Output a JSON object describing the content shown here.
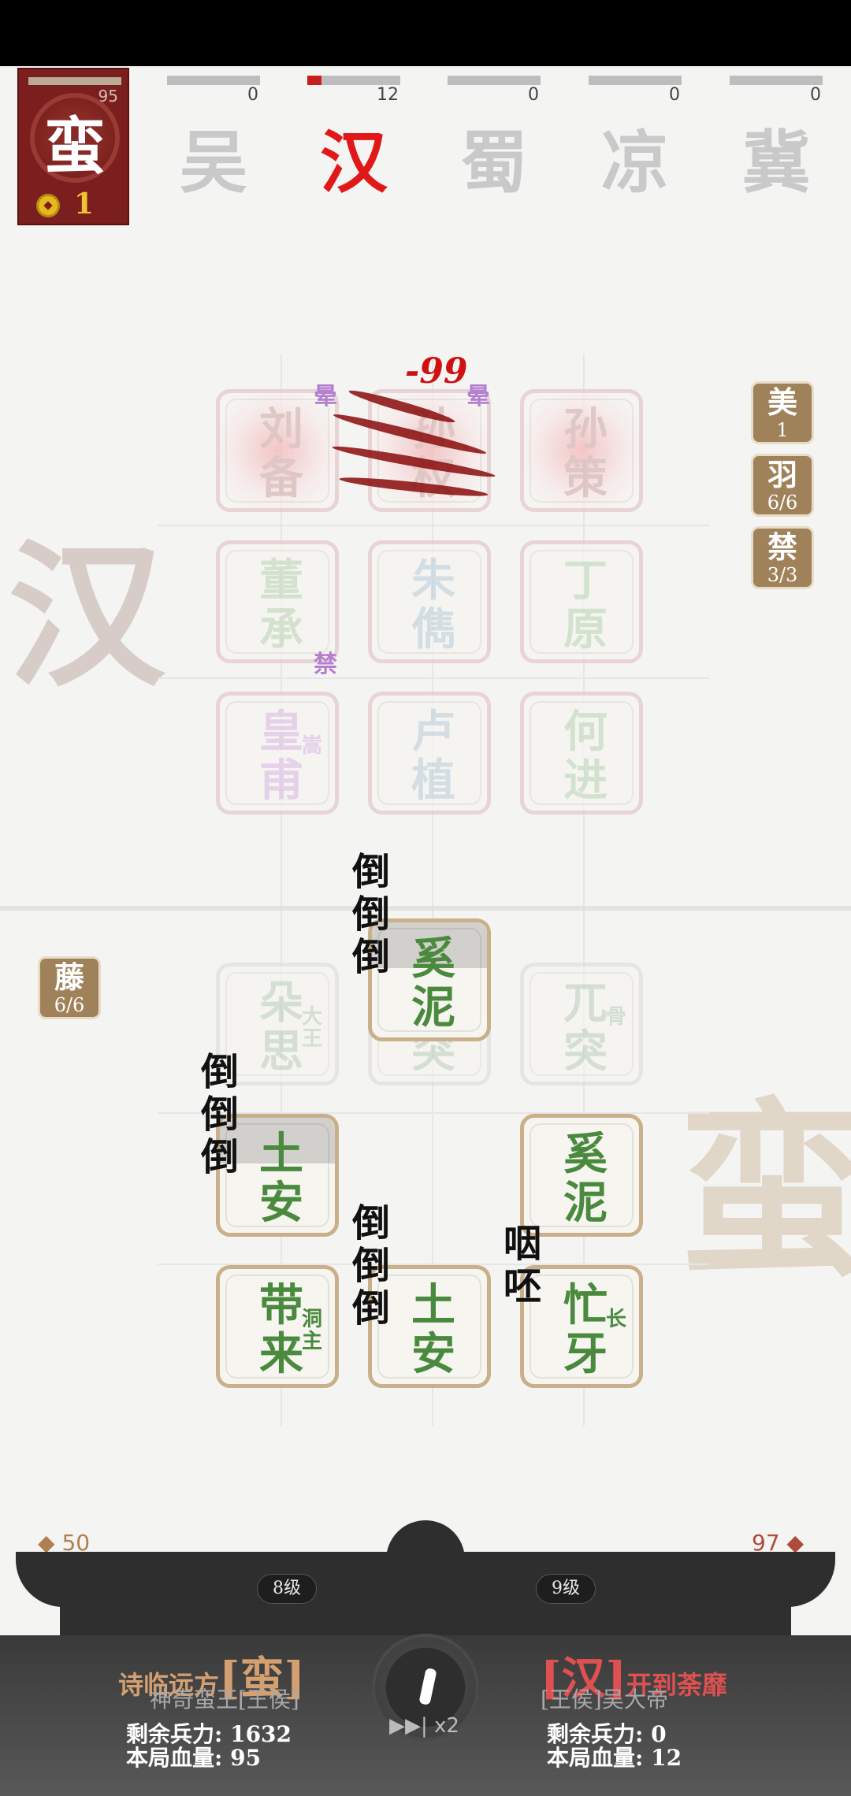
{
  "player": {
    "glyph": "蛮",
    "hp": "95",
    "coins": "1"
  },
  "factions": [
    {
      "name": "吴",
      "value": "0",
      "progress": 0,
      "active": false
    },
    {
      "name": "汉",
      "value": "12",
      "progress": 0.15,
      "active": true
    },
    {
      "name": "蜀",
      "value": "0",
      "progress": 0,
      "active": false
    },
    {
      "name": "凉",
      "value": "0",
      "progress": 0,
      "active": false
    },
    {
      "name": "冀",
      "value": "0",
      "progress": 0,
      "active": false
    }
  ],
  "damage_text": "-99",
  "enemy_tiles": [
    {
      "t1": "刘",
      "t2": "备",
      "sub": ""
    },
    {
      "t1": "孙",
      "t2": "权",
      "sub": ""
    },
    {
      "t1": "孙",
      "t2": "策",
      "sub": ""
    },
    {
      "t1": "董",
      "t2": "承",
      "sub": ""
    },
    {
      "t1": "朱",
      "t2": "儁",
      "sub": ""
    },
    {
      "t1": "丁",
      "t2": "原",
      "sub": ""
    },
    {
      "t1": "皇",
      "t2": "甫",
      "sub": "嵩"
    },
    {
      "t1": "卢",
      "t2": "植",
      "sub": ""
    },
    {
      "t1": "何",
      "t2": "进",
      "sub": ""
    }
  ],
  "status_tags": {
    "stun1": "晕",
    "stun2": "晕",
    "ban": "禁"
  },
  "right_badges": [
    {
      "label": "美",
      "value": "1"
    },
    {
      "label": "羽",
      "value": "6/6"
    },
    {
      "label": "禁",
      "value": "3/3"
    }
  ],
  "left_badge": {
    "label": "藤",
    "value": "6/6"
  },
  "ally_tiles": {
    "xini_center": {
      "t1": "奚",
      "t2": "泥",
      "sub": ""
    },
    "duosi": {
      "t1": "朵",
      "t2": "思",
      "sub": "大王"
    },
    "under_xini": {
      "t1": "",
      "t2": "突",
      "sub": ""
    },
    "wutu": {
      "t1": "兀",
      "t2": "突",
      "sub": "骨"
    },
    "tuan_left": {
      "t1": "土",
      "t2": "安",
      "sub": ""
    },
    "xini_right": {
      "t1": "奚",
      "t2": "泥",
      "sub": ""
    },
    "dailai": {
      "t1": "带",
      "t2": "来",
      "sub": "洞主"
    },
    "tuan_bottom": {
      "t1": "土",
      "t2": "安",
      "sub": ""
    },
    "mangya": {
      "t1": "忙",
      "t2": "牙",
      "sub": "长"
    }
  },
  "fall_marks": {
    "mark1": "倒倒倒",
    "mark2": "倒倒倒",
    "mark3": "倒倒倒",
    "shout": "咽呸"
  },
  "watermarks": {
    "left": "汉",
    "right": "蛮"
  },
  "bottom": {
    "left_count": "50",
    "right_count": "97",
    "left_level": "8级",
    "right_level": "9级",
    "speed": "▶▶| x2",
    "left": {
      "prefix": "诗临远方",
      "faction": "[蛮]",
      "player_name": "神奇蛮王[王侯]",
      "troops_label": "剩余兵力:",
      "troops": "1632",
      "hp_label": "本局血量:",
      "hp": "95"
    },
    "right": {
      "faction": "[汉]",
      "suffix": "开到荼靡",
      "player_name": "[王侯]吴大帝",
      "troops_label": "剩余兵力:",
      "troops": "0",
      "hp_label": "本局血量:",
      "hp": "12"
    }
  },
  "colors": {
    "enemy_red": "#e01818",
    "ally_green": "#4a8a3e",
    "badge_brown": "#a0825a"
  }
}
